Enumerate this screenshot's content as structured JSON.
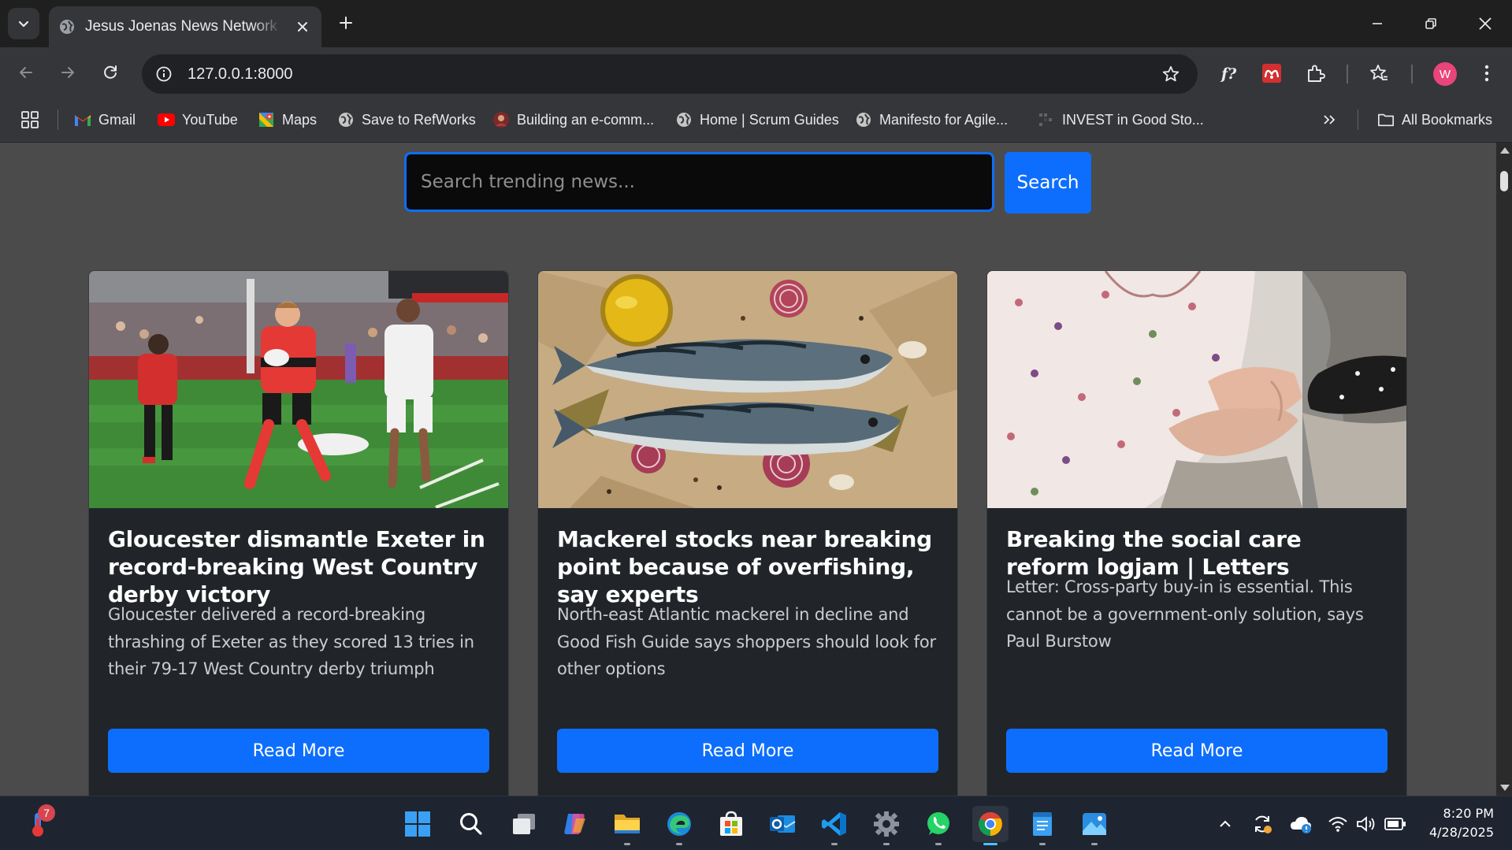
{
  "browser": {
    "tab": {
      "title": "Jesus Joenas News Network | H",
      "favicon": "globe-icon"
    },
    "address_bar": {
      "url": "127.0.0.1:8000"
    },
    "profile_initial": "W",
    "bookmarks": [
      {
        "label": "Gmail",
        "icon": "gmail-icon"
      },
      {
        "label": "YouTube",
        "icon": "youtube-icon"
      },
      {
        "label": "Maps",
        "icon": "maps-icon"
      },
      {
        "label": "Save to RefWorks",
        "icon": "globe-icon"
      },
      {
        "label": "Building an e-comm...",
        "icon": "site-icon"
      },
      {
        "label": "Home | Scrum Guides",
        "icon": "globe-icon"
      },
      {
        "label": "Manifesto for Agile...",
        "icon": "globe-icon"
      },
      {
        "label": "INVEST in Good Sto...",
        "icon": "site-icon"
      }
    ],
    "all_bookmarks_label": "All Bookmarks"
  },
  "page": {
    "search": {
      "placeholder": "Search trending news...",
      "button_label": "Search"
    },
    "articles": [
      {
        "title": "Gloucester dismantle Exeter in record-breaking West Country derby victory",
        "description": "Gloucester delivered a record-breaking thrashing of Exeter as they scored 13 tries in their 79-17 West Country derby triumph",
        "button_label": "Read More"
      },
      {
        "title": "Mackerel stocks near breaking point because of overfishing, say experts",
        "description": "North-east Atlantic mackerel in decline and Good Fish Guide says shoppers should look for other options",
        "button_label": "Read More"
      },
      {
        "title": "Breaking the social care reform logjam | Letters",
        "description": "Letter: Cross-party buy-in is essential. This cannot be a government-only solution, says Paul Burstow",
        "button_label": "Read More"
      }
    ]
  },
  "taskbar": {
    "notification_count": "7",
    "time": "8:20 PM",
    "date": "4/28/2025"
  },
  "colors": {
    "accent": "#0d6efd",
    "card_bg": "#212529",
    "page_bg": "#4b4b4b"
  }
}
